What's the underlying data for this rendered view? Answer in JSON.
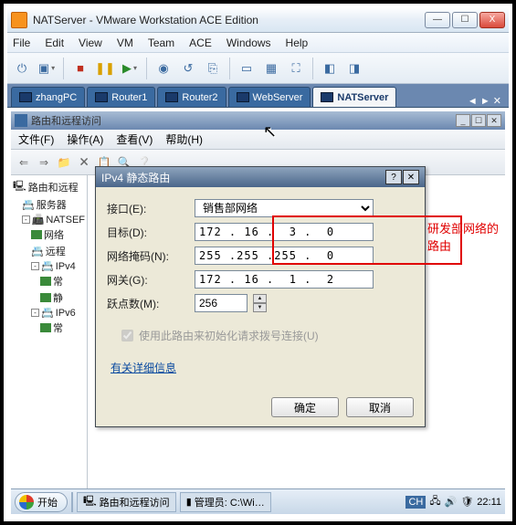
{
  "vm": {
    "title": "NATServer - VMware Workstation ACE Edition",
    "menu": [
      "File",
      "Edit",
      "View",
      "VM",
      "Team",
      "ACE",
      "Windows",
      "Help"
    ],
    "tabs": [
      {
        "label": "zhangPC"
      },
      {
        "label": "Router1"
      },
      {
        "label": "Router2"
      },
      {
        "label": "WebServer"
      },
      {
        "label": "NATServer",
        "active": true
      }
    ],
    "winbtns": {
      "min": "—",
      "max": "☐",
      "close": "X"
    }
  },
  "guest": {
    "title": "路由和远程访问",
    "menu": {
      "file": "文件(F)",
      "action": "操作(A)",
      "view": "查看(V)",
      "help": "帮助(H)"
    },
    "tree": {
      "root": "路由和远程",
      "srv": "服务器",
      "node": "NATSEF",
      "n1": "网络",
      "n2": "远程",
      "n3": "IPv4",
      "n4": "常",
      "n5": "静",
      "n6": "IPv6",
      "n7": "常"
    }
  },
  "dialog": {
    "title": "IPv4 静态路由",
    "labels": {
      "iface": "接口(E):",
      "dest": "目标(D):",
      "mask": "网络掩码(N):",
      "gw": "网关(G):",
      "metric": "跃点数(M):",
      "chk": "使用此路由来初始化请求拨号连接(U)",
      "link": "有关详细信息",
      "ok": "确定",
      "cancel": "取消"
    },
    "values": {
      "iface": "销售部网络",
      "dest": "172 . 16 .  3 .  0",
      "mask": "255 .255 .255 .  0",
      "gw": "172 . 16 .  1 .  2",
      "metric": "256"
    },
    "annotation": "研发部网络的路由",
    "help": "?"
  },
  "taskbar": {
    "start": "开始",
    "btn1": "路由和远程访问",
    "btn2": "管理员: C:\\Wi…",
    "lang": "CH",
    "time": "22:11"
  }
}
